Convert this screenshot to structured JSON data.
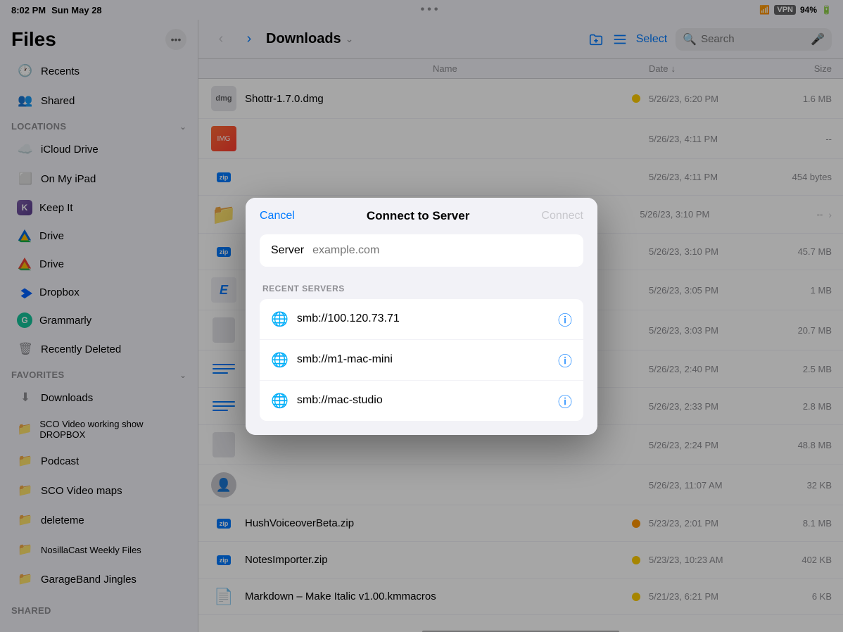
{
  "statusBar": {
    "time": "8:02 PM",
    "date": "Sun May 28",
    "wifi": "WiFi",
    "vpn": "VPN",
    "battery": "94%"
  },
  "topDots": "•••",
  "sidebar": {
    "title": "Files",
    "sections": {
      "recents": "Recents",
      "shared": "Shared",
      "locations": "Locations",
      "favorites": "Favorites",
      "sharedBottom": "Shared"
    },
    "items": [
      {
        "id": "recents",
        "label": "Recents",
        "icon": "clock"
      },
      {
        "id": "shared",
        "label": "Shared",
        "icon": "person"
      },
      {
        "id": "icloud",
        "label": "iCloud Drive",
        "icon": "icloud"
      },
      {
        "id": "on-my-ipad",
        "label": "On My iPad",
        "icon": "ipad"
      },
      {
        "id": "keep-it",
        "label": "Keep It",
        "icon": "keepit"
      },
      {
        "id": "drive1",
        "label": "Drive",
        "icon": "gdrive"
      },
      {
        "id": "drive2",
        "label": "Drive",
        "icon": "gdrive2"
      },
      {
        "id": "dropbox",
        "label": "Dropbox",
        "icon": "dropbox"
      },
      {
        "id": "grammarly",
        "label": "Grammarly",
        "icon": "grammarly"
      },
      {
        "id": "recently-deleted",
        "label": "Recently Deleted",
        "icon": "trash"
      },
      {
        "id": "downloads",
        "label": "Downloads",
        "icon": "folder"
      },
      {
        "id": "sco-video",
        "label": "SCO Video working show DROPBOX",
        "icon": "folder"
      },
      {
        "id": "podcast",
        "label": "Podcast",
        "icon": "folder"
      },
      {
        "id": "sco-maps",
        "label": "SCO Video maps",
        "icon": "folder"
      },
      {
        "id": "deleteme",
        "label": "deleteme",
        "icon": "folder"
      },
      {
        "id": "nosilla",
        "label": "NosillaCast Weekly Files",
        "icon": "folder"
      },
      {
        "id": "garageband",
        "label": "GarageBand Jingles",
        "icon": "folder"
      }
    ]
  },
  "toolbar": {
    "back_disabled": true,
    "forward_label": "›",
    "title": "Downloads",
    "select_label": "Select",
    "search_placeholder": "Search"
  },
  "table": {
    "col_name": "Name",
    "col_date": "Date",
    "col_size": "Size",
    "files": [
      {
        "icon": "dmg",
        "name": "Shottr-1.7.0.dmg",
        "badge": "yellow",
        "date": "5/26/23, 6:20 PM",
        "size": "1.6 MB",
        "arrow": false
      },
      {
        "icon": "img",
        "name": "",
        "badge": "",
        "date": "5/26/23, 4:11 PM",
        "size": "--",
        "arrow": false
      },
      {
        "icon": "zip",
        "name": "",
        "badge": "",
        "date": "5/26/23, 4:11 PM",
        "size": "454 bytes",
        "arrow": false
      },
      {
        "icon": "folder",
        "name": "",
        "badge": "",
        "date": "5/26/23, 3:10 PM",
        "size": "--",
        "arrow": true
      },
      {
        "icon": "zip",
        "name": "",
        "badge": "",
        "date": "5/26/23, 3:10 PM",
        "size": "45.7 MB",
        "arrow": false
      },
      {
        "icon": "epub",
        "name": "",
        "badge": "",
        "date": "5/26/23, 3:05 PM",
        "size": "1 MB",
        "arrow": false
      },
      {
        "icon": "blank",
        "name": "",
        "badge": "",
        "date": "5/26/23, 3:03 PM",
        "size": "20.7 MB",
        "arrow": false
      },
      {
        "icon": "lines",
        "name": "",
        "badge": "",
        "date": "5/26/23, 2:40 PM",
        "size": "2.5 MB",
        "arrow": false
      },
      {
        "icon": "lines",
        "name": "",
        "badge": "",
        "date": "5/26/23, 2:33 PM",
        "size": "2.8 MB",
        "arrow": false
      },
      {
        "icon": "blank2",
        "name": "",
        "badge": "",
        "date": "5/26/23, 2:24 PM",
        "size": "48.8 MB",
        "arrow": false
      },
      {
        "icon": "person",
        "name": "",
        "badge": "",
        "date": "5/26/23, 11:07 AM",
        "size": "32 KB",
        "arrow": false
      },
      {
        "icon": "zip",
        "name": "HushVoiceoverBeta.zip",
        "badge": "orange",
        "date": "5/23/23, 2:01 PM",
        "size": "8.1 MB",
        "arrow": false
      },
      {
        "icon": "zip",
        "name": "NotesImporter.zip",
        "badge": "yellow",
        "date": "5/23/23, 10:23 AM",
        "size": "402 KB",
        "arrow": false
      },
      {
        "icon": "script",
        "name": "Markdown – Make Italic v1.00.kmmacros",
        "badge": "yellow",
        "date": "5/21/23, 6:21 PM",
        "size": "6 KB",
        "arrow": false
      }
    ]
  },
  "modal": {
    "title": "Connect to Server",
    "cancel_label": "Cancel",
    "connect_label": "Connect",
    "server_label": "Server",
    "server_placeholder": "example.com",
    "recent_servers_label": "RECENT SERVERS",
    "servers": [
      {
        "id": "server1",
        "address": "smb://100.120.73.71"
      },
      {
        "id": "server2",
        "address": "smb://m1-mac-mini"
      },
      {
        "id": "server3",
        "address": "smb://mac-studio"
      }
    ]
  }
}
